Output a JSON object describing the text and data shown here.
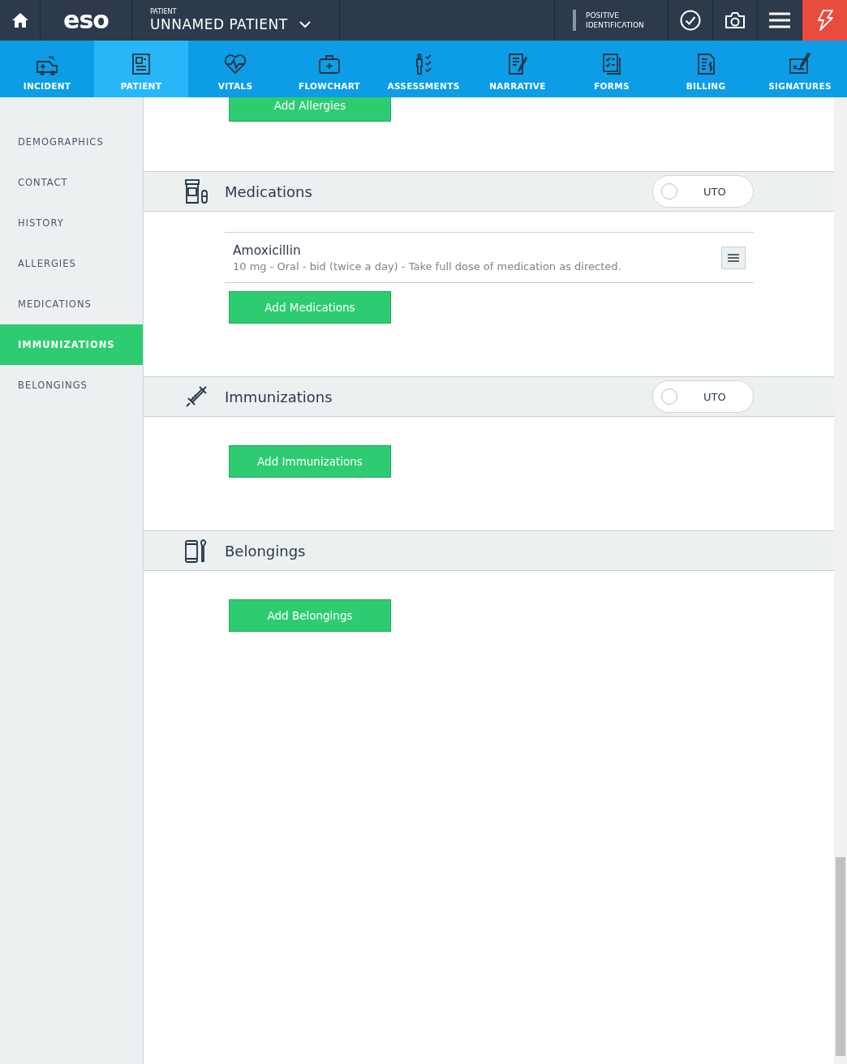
{
  "header": {
    "logo": "eso",
    "patient_label": "PATIENT",
    "patient_name": "UNNAMED PATIENT",
    "identification": "POSITIVE IDENTIFICATION"
  },
  "nav": [
    {
      "label": "INCIDENT",
      "selected": false
    },
    {
      "label": "PATIENT",
      "selected": true
    },
    {
      "label": "VITALS",
      "selected": false
    },
    {
      "label": "FLOWCHART",
      "selected": false
    },
    {
      "label": "ASSESSMENTS",
      "selected": false
    },
    {
      "label": "NARRATIVE",
      "selected": false
    },
    {
      "label": "FORMS",
      "selected": false
    },
    {
      "label": "BILLING",
      "selected": false
    },
    {
      "label": "SIGNATURES",
      "selected": false
    }
  ],
  "sidebar": {
    "items": [
      {
        "label": "DEMOGRAPHICS",
        "selected": false
      },
      {
        "label": "CONTACT",
        "selected": false
      },
      {
        "label": "HISTORY",
        "selected": false
      },
      {
        "label": "ALLERGIES",
        "selected": false
      },
      {
        "label": "MEDICATIONS",
        "selected": false
      },
      {
        "label": "IMMUNIZATIONS",
        "selected": true
      },
      {
        "label": "BELONGINGS",
        "selected": false
      }
    ]
  },
  "partial_button": "Add Allergies",
  "sections": [
    {
      "title": "Medications",
      "uto": {
        "label": "UTO",
        "on": false
      },
      "items": [
        {
          "name": "Amoxicillin",
          "detail": "10 mg - Oral - bid (twice a day) - Take full dose of medication as directed."
        }
      ],
      "button": "Add Medications"
    },
    {
      "title": "Immunizations",
      "uto": {
        "label": "UTO",
        "on": false
      },
      "button": "Add Immunizations"
    },
    {
      "title": "Belongings",
      "button": "Add Belongings"
    }
  ]
}
